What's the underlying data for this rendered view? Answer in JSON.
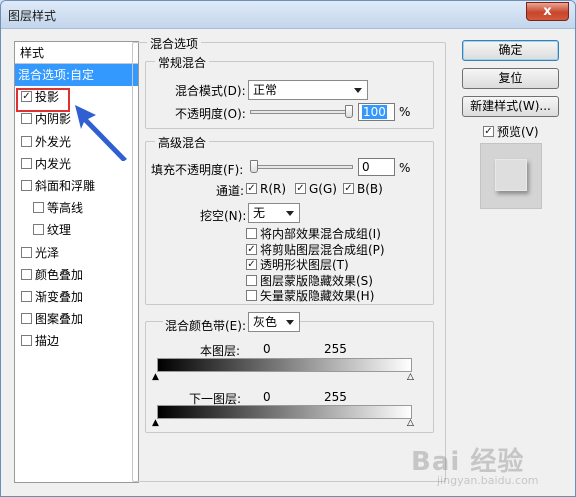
{
  "window": {
    "title": "图层样式",
    "close": "x"
  },
  "style_list": {
    "header": "样式",
    "items": [
      {
        "label": "混合选项:自定",
        "checkbox": false,
        "checked": false,
        "indent": false,
        "selected": true
      },
      {
        "label": "投影",
        "checkbox": true,
        "checked": true,
        "indent": false,
        "selected": false
      },
      {
        "label": "内阴影",
        "checkbox": true,
        "checked": false,
        "indent": false,
        "selected": false
      },
      {
        "label": "外发光",
        "checkbox": true,
        "checked": false,
        "indent": false,
        "selected": false
      },
      {
        "label": "内发光",
        "checkbox": true,
        "checked": false,
        "indent": false,
        "selected": false
      },
      {
        "label": "斜面和浮雕",
        "checkbox": true,
        "checked": false,
        "indent": false,
        "selected": false
      },
      {
        "label": "等高线",
        "checkbox": true,
        "checked": false,
        "indent": true,
        "selected": false
      },
      {
        "label": "纹理",
        "checkbox": true,
        "checked": false,
        "indent": true,
        "selected": false
      },
      {
        "label": "光泽",
        "checkbox": true,
        "checked": false,
        "indent": false,
        "selected": false
      },
      {
        "label": "颜色叠加",
        "checkbox": true,
        "checked": false,
        "indent": false,
        "selected": false
      },
      {
        "label": "渐变叠加",
        "checkbox": true,
        "checked": false,
        "indent": false,
        "selected": false
      },
      {
        "label": "图案叠加",
        "checkbox": true,
        "checked": false,
        "indent": false,
        "selected": false
      },
      {
        "label": "描边",
        "checkbox": true,
        "checked": false,
        "indent": false,
        "selected": false
      }
    ]
  },
  "blending": {
    "group_label": "混合选项",
    "general": {
      "label": "常规混合",
      "mode_label": "混合模式(D):",
      "mode_value": "正常",
      "opacity_label": "不透明度(O):",
      "opacity_value": "100",
      "opacity_unit": "%",
      "opacity_level": 100
    },
    "advanced": {
      "label": "高级混合",
      "fill_label": "填充不透明度(F):",
      "fill_value": "0",
      "fill_unit": "%",
      "fill_level": 0,
      "channels_label": "通道:",
      "channels": [
        {
          "label": "R(R)",
          "checked": true
        },
        {
          "label": "G(G)",
          "checked": true
        },
        {
          "label": "B(B)",
          "checked": true
        }
      ],
      "knockout_label": "挖空(N):",
      "knockout_value": "无",
      "options": [
        {
          "label": "将内部效果混合成组(I)",
          "checked": false
        },
        {
          "label": "将剪贴图层混合成组(P)",
          "checked": true
        },
        {
          "label": "透明形状图层(T)",
          "checked": true
        },
        {
          "label": "图层蒙版隐藏效果(S)",
          "checked": false
        },
        {
          "label": "矢量蒙版隐藏效果(H)",
          "checked": false
        }
      ]
    },
    "blend_if": {
      "label": "混合颜色带(E):",
      "value": "灰色",
      "this_layer": {
        "label": "本图层:",
        "low": "0",
        "high": "255"
      },
      "underlying": {
        "label": "下一图层:",
        "low": "0",
        "high": "255"
      }
    }
  },
  "buttons": {
    "ok": "确定",
    "reset": "复位",
    "new_style": "新建样式(W)...",
    "preview": "预览(V)",
    "preview_checked": true
  },
  "watermark": {
    "main": "Bai 经验",
    "sub": "jingyan.baidu.com"
  },
  "colors": {
    "accent": "#3399ff",
    "highlight_box": "#e03030",
    "arrow": "#2f5fd0"
  }
}
